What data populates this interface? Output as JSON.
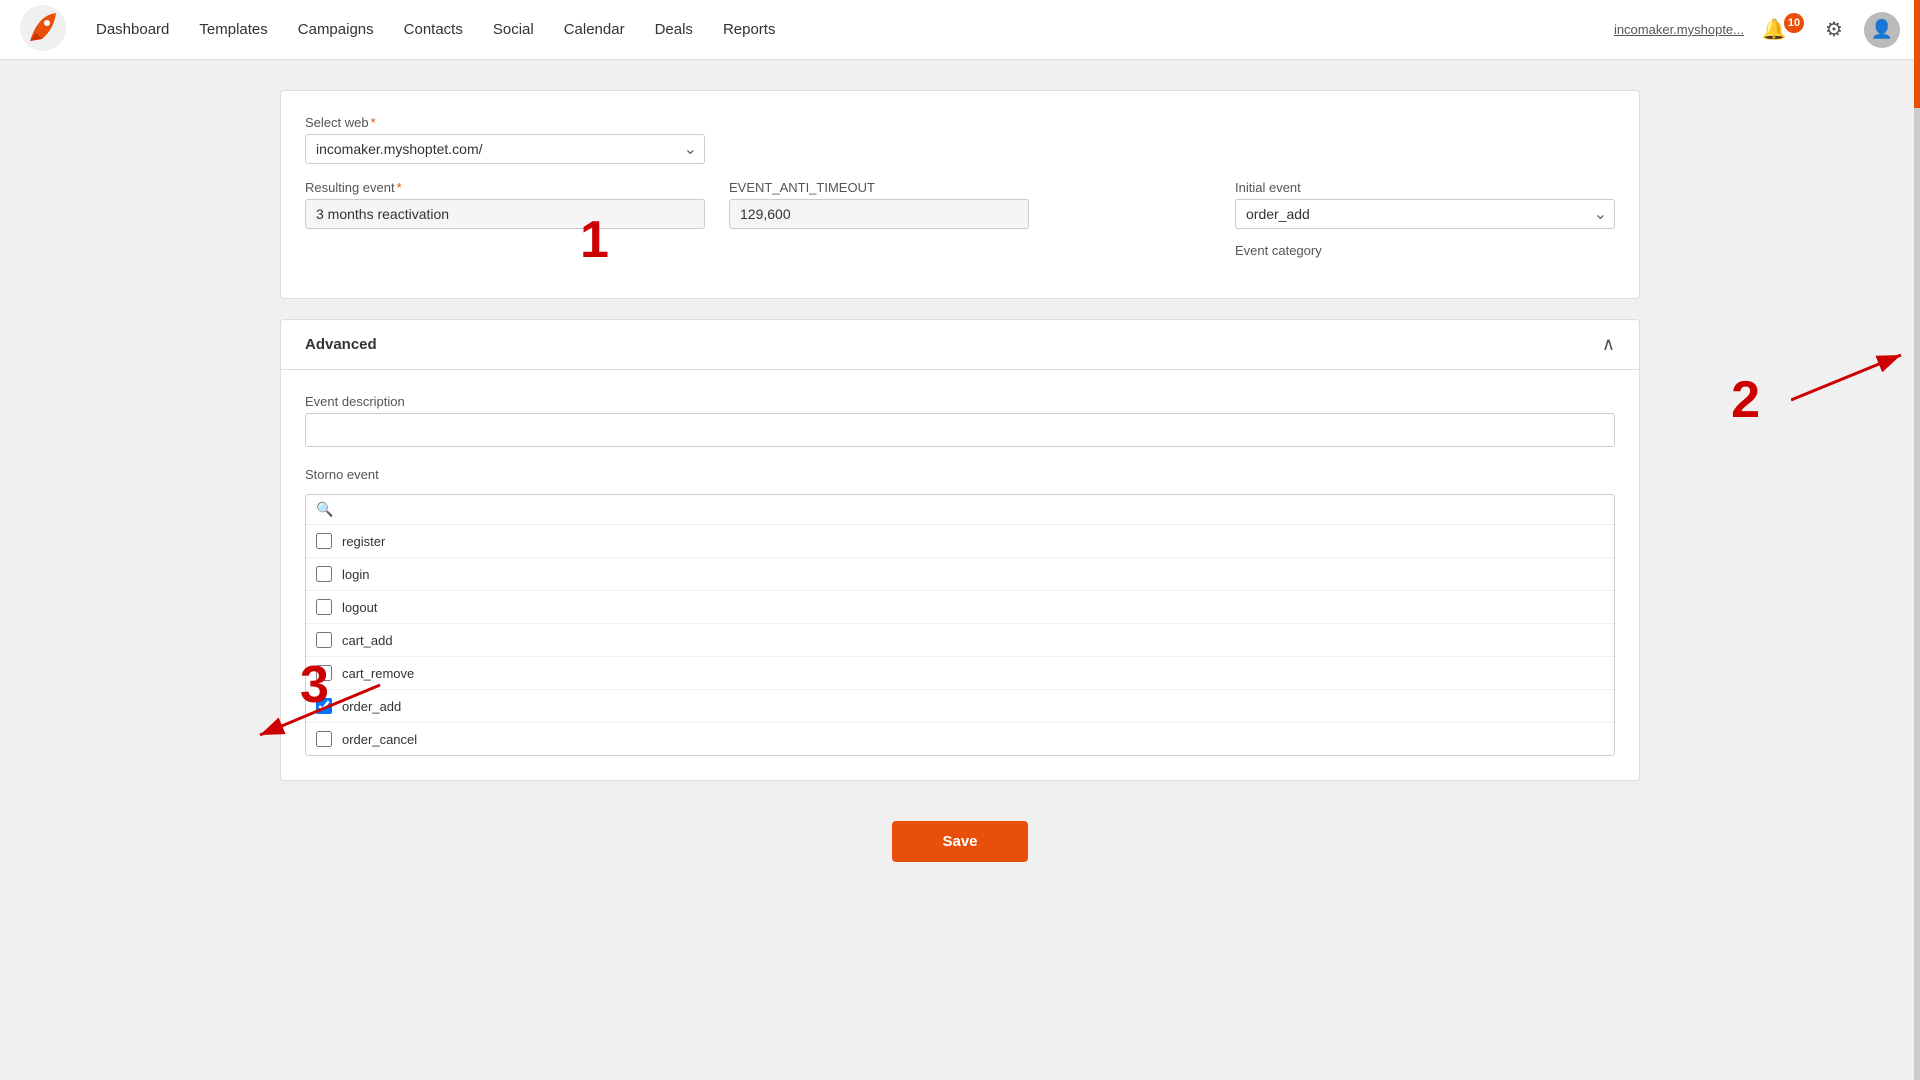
{
  "navbar": {
    "logo_alt": "Incomaker logo",
    "links": [
      {
        "label": "Dashboard",
        "id": "dashboard"
      },
      {
        "label": "Templates",
        "id": "templates"
      },
      {
        "label": "Campaigns",
        "id": "campaigns"
      },
      {
        "label": "Contacts",
        "id": "contacts"
      },
      {
        "label": "Social",
        "id": "social"
      },
      {
        "label": "Calendar",
        "id": "calendar"
      },
      {
        "label": "Deals",
        "id": "deals"
      },
      {
        "label": "Reports",
        "id": "reports"
      }
    ],
    "user_link": "incomaker.myshopte...",
    "notification_count": "10"
  },
  "form": {
    "select_web_label": "Select web",
    "select_web_value": "incomaker.myshoptet.com/",
    "resulting_event_label": "Resulting event",
    "resulting_event_value": "3 months reactivation",
    "event_anti_timeout_label": "EVENT_ANTI_TIMEOUT",
    "event_anti_timeout_value": "129,600",
    "initial_event_label": "Initial event",
    "initial_event_value": "order_add",
    "event_category_label": "Event category"
  },
  "advanced": {
    "title": "Advanced",
    "event_description_label": "Event description",
    "event_description_value": "",
    "event_description_placeholder": "",
    "storno_event_label": "Storno event",
    "storno_search_placeholder": "",
    "storno_items": [
      {
        "id": "register",
        "label": "register",
        "checked": false
      },
      {
        "id": "login",
        "label": "login",
        "checked": false
      },
      {
        "id": "logout",
        "label": "logout",
        "checked": false
      },
      {
        "id": "cart_add",
        "label": "cart_add",
        "checked": false
      },
      {
        "id": "cart_remove",
        "label": "cart_remove",
        "checked": false
      },
      {
        "id": "order_add",
        "label": "order_add",
        "checked": true
      },
      {
        "id": "order_cancel",
        "label": "order_cancel",
        "checked": false
      }
    ]
  },
  "save_button_label": "Save",
  "annotations": {
    "one": "1",
    "two": "2",
    "three": "3"
  }
}
